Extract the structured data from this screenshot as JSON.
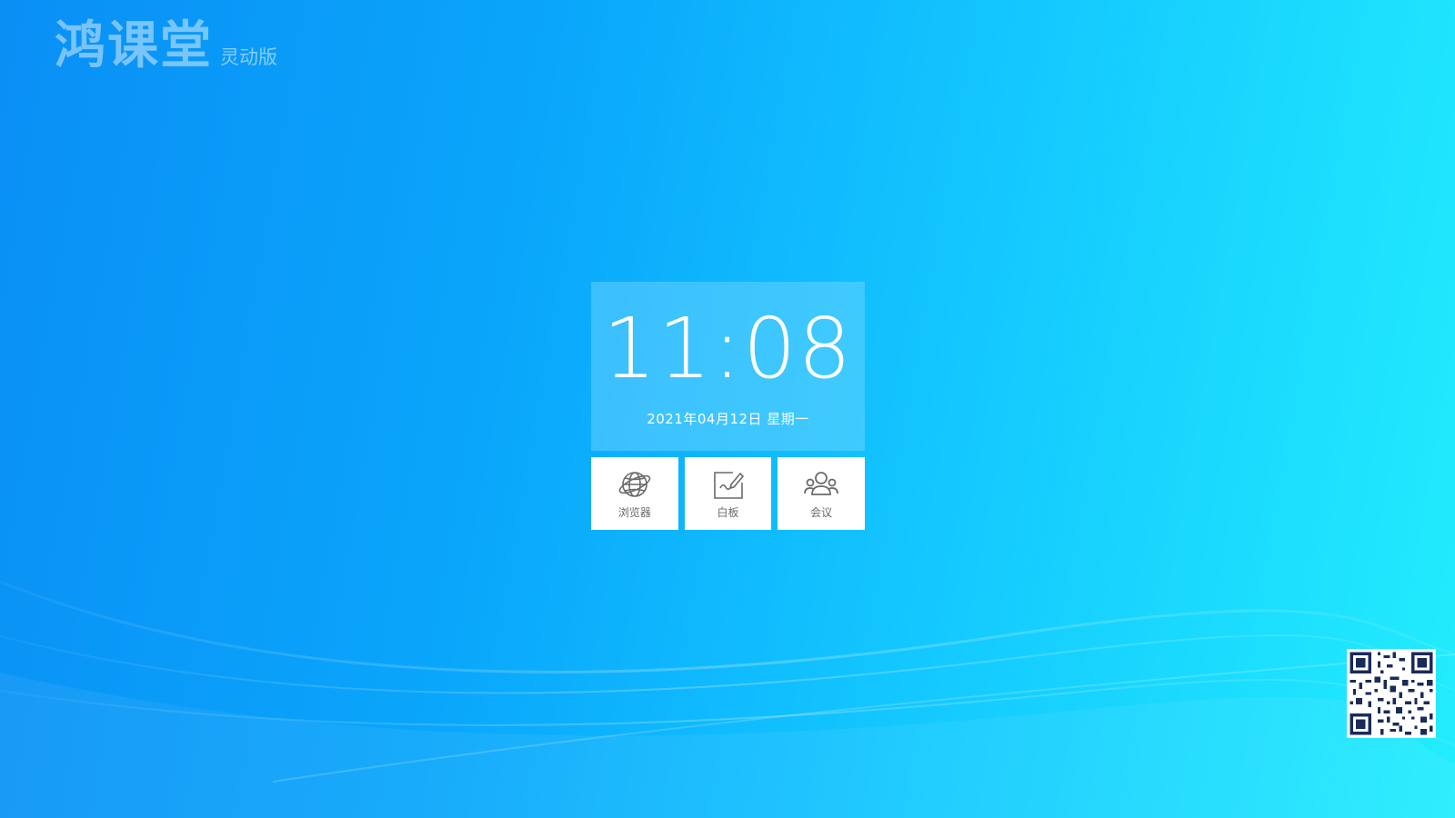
{
  "logo": {
    "title": "鸿课堂",
    "edition": "灵动版"
  },
  "clock": {
    "time": "11:08",
    "date": "2021年04月12日  星期一"
  },
  "apps": [
    {
      "label": "浏览器",
      "icon": "globe-icon"
    },
    {
      "label": "白板",
      "icon": "whiteboard-icon"
    },
    {
      "label": "会议",
      "icon": "meeting-icon"
    }
  ],
  "colors": {
    "background_start": "#0a8ff5",
    "background_end": "#22edfd",
    "tile_background": "#ffffff",
    "icon_color": "#6a6a6a"
  }
}
